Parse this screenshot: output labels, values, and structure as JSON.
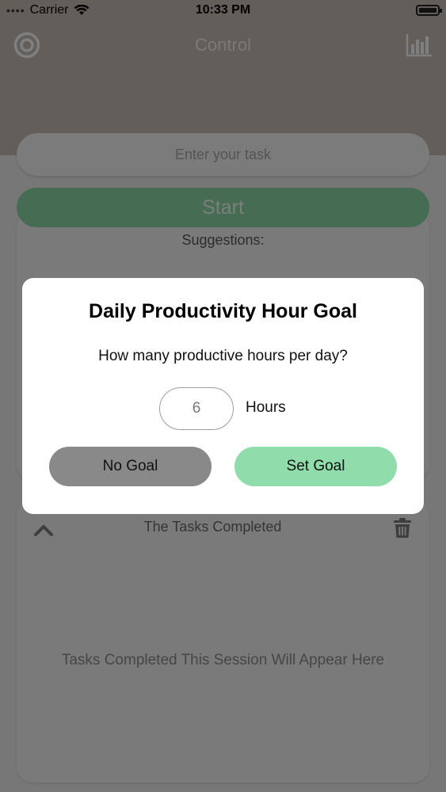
{
  "status_bar": {
    "carrier": "Carrier",
    "time": "10:33 PM"
  },
  "nav": {
    "title": "Control",
    "left_icon": "target-icon",
    "right_icon": "bar-chart-icon"
  },
  "task_input": {
    "placeholder": "Enter your task"
  },
  "start_button": {
    "label": "Start"
  },
  "suggestions": {
    "title": "Suggestions:"
  },
  "tasks_panel": {
    "title": "The Tasks Completed",
    "empty_text": "Tasks Completed This Session Will Appear Here"
  },
  "modal": {
    "title": "Daily Productivity Hour Goal",
    "question": "How many productive hours per day?",
    "hours_value": "6",
    "hours_unit": "Hours",
    "no_goal_label": "No Goal",
    "set_goal_label": "Set Goal"
  },
  "colors": {
    "header": "#c8bdb6",
    "start_green": "#8ed9a8",
    "set_goal_green": "#90dcab",
    "no_goal_gray": "#898989",
    "background": "#efefef"
  }
}
